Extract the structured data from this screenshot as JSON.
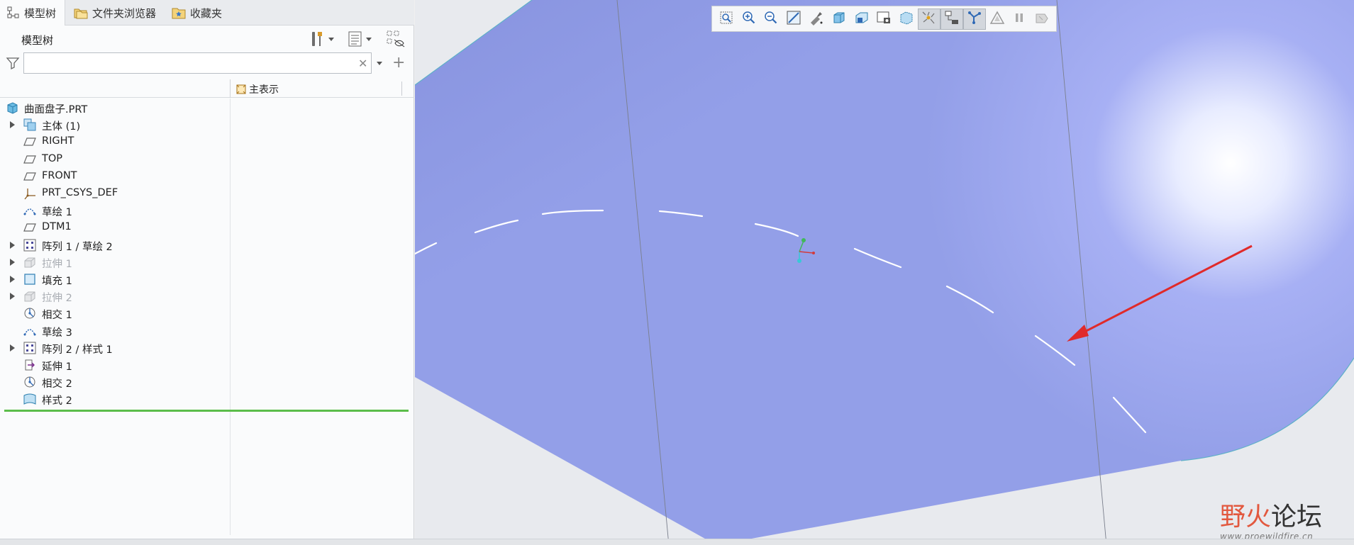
{
  "tabs": [
    {
      "label": "模型树",
      "active": true,
      "icon": "model-tree-icon"
    },
    {
      "label": "文件夹浏览器",
      "active": false,
      "icon": "folder-icon"
    },
    {
      "label": "收藏夹",
      "active": false,
      "icon": "favorites-icon"
    }
  ],
  "tree_panel": {
    "title": "模型树",
    "search": {
      "value": "",
      "placeholder": ""
    },
    "column_header": "主表示"
  },
  "tree_items": [
    {
      "label": "曲面盘子.PRT",
      "icon": "part-icon",
      "expandable": false,
      "dimmed": false,
      "root": true
    },
    {
      "label": "主体 (1)",
      "icon": "body-icon",
      "expandable": true,
      "dimmed": false
    },
    {
      "label": "RIGHT",
      "icon": "datum-plane-icon",
      "expandable": false,
      "dimmed": false
    },
    {
      "label": "TOP",
      "icon": "datum-plane-icon",
      "expandable": false,
      "dimmed": false
    },
    {
      "label": "FRONT",
      "icon": "datum-plane-icon",
      "expandable": false,
      "dimmed": false
    },
    {
      "label": "PRT_CSYS_DEF",
      "icon": "csys-icon",
      "expandable": false,
      "dimmed": false
    },
    {
      "label": "草绘 1",
      "icon": "sketch-icon",
      "expandable": false,
      "dimmed": false
    },
    {
      "label": "DTM1",
      "icon": "datum-plane-icon",
      "expandable": false,
      "dimmed": false
    },
    {
      "label": "阵列 1 / 草绘 2",
      "icon": "pattern-icon",
      "expandable": true,
      "dimmed": false
    },
    {
      "label": "拉伸 1",
      "icon": "extrude-icon",
      "expandable": true,
      "dimmed": true
    },
    {
      "label": "填充 1",
      "icon": "fill-icon",
      "expandable": true,
      "dimmed": false
    },
    {
      "label": "拉伸 2",
      "icon": "extrude-icon",
      "expandable": true,
      "dimmed": true
    },
    {
      "label": "相交 1",
      "icon": "intersect-icon",
      "expandable": false,
      "dimmed": false
    },
    {
      "label": "草绘 3",
      "icon": "sketch-icon",
      "expandable": false,
      "dimmed": false
    },
    {
      "label": "阵列 2 / 样式 1",
      "icon": "pattern-icon",
      "expandable": true,
      "dimmed": false
    },
    {
      "label": "延伸 1",
      "icon": "extend-icon",
      "expandable": false,
      "dimmed": false
    },
    {
      "label": "相交 2",
      "icon": "intersect-icon",
      "expandable": false,
      "dimmed": false
    },
    {
      "label": "样式 2",
      "icon": "style-icon",
      "expandable": false,
      "dimmed": false
    }
  ],
  "view_toolbar": [
    {
      "name": "refit-icon"
    },
    {
      "name": "zoom-in-icon"
    },
    {
      "name": "zoom-out-icon"
    },
    {
      "name": "repaint-icon"
    },
    {
      "name": "spin-center-icon"
    },
    {
      "name": "display-style-icon"
    },
    {
      "name": "saved-orientations-icon"
    },
    {
      "name": "view-manager-icon"
    },
    {
      "name": "perspective-icon"
    },
    {
      "name": "datum-display-icon",
      "active": true
    },
    {
      "name": "annotation-display-icon",
      "active": true
    },
    {
      "name": "section-icon",
      "active": true
    },
    {
      "name": "triangle-icon"
    },
    {
      "name": "pause-icon"
    },
    {
      "name": "exit-icon"
    }
  ],
  "watermark": {
    "main_red": "野火",
    "main_dark": "论坛",
    "url": "www.proewildfire.cn"
  },
  "colors": {
    "surface": "#97a2ea",
    "highlight": "#ffffff",
    "arrow": "#e02a2a",
    "insert_line": "#5bbd4a"
  }
}
